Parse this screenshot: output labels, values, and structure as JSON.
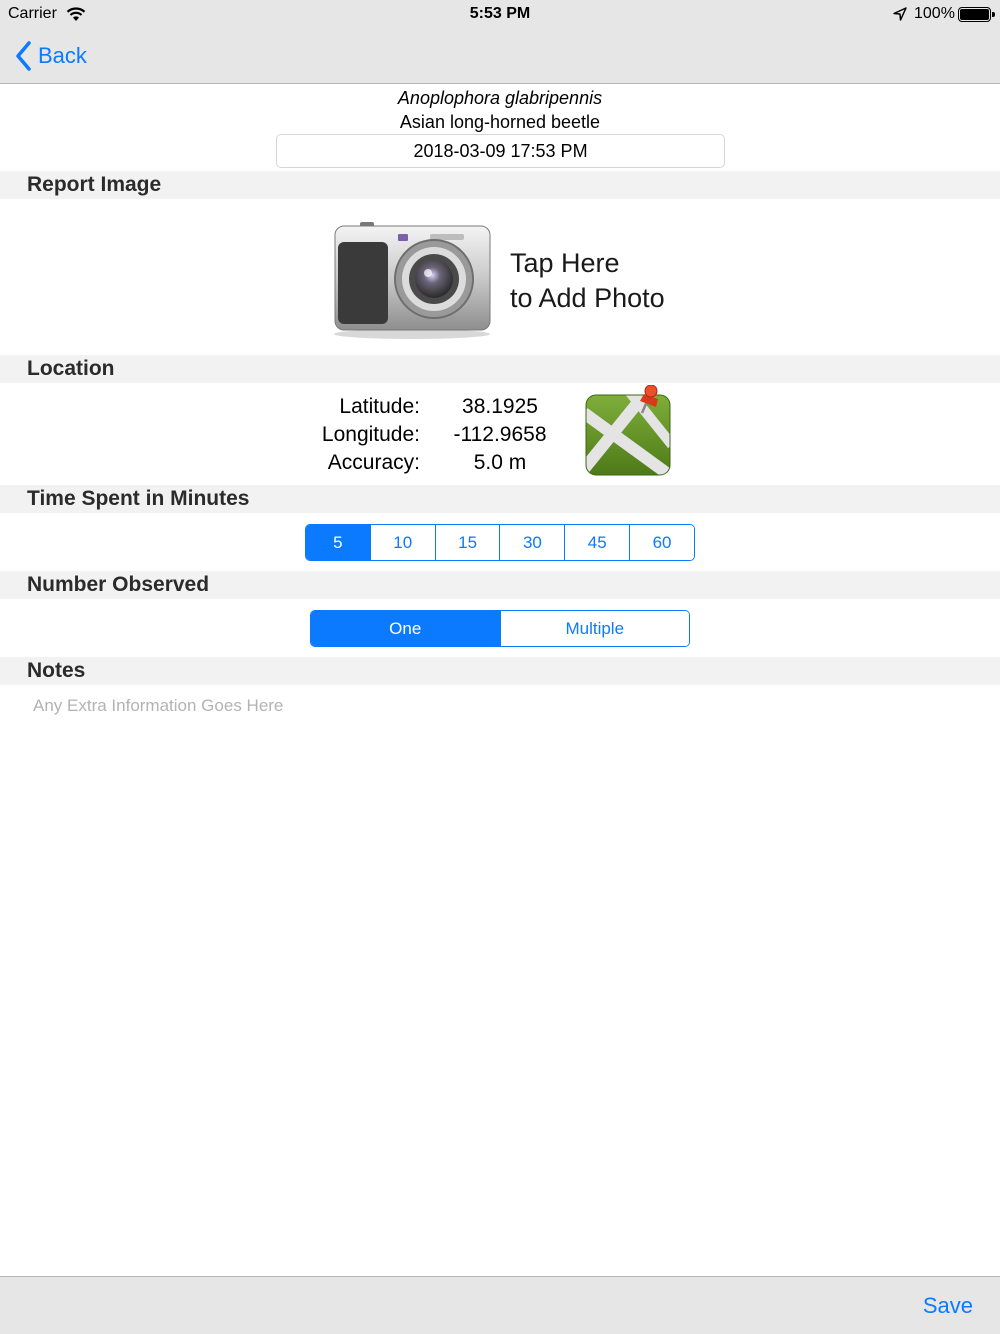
{
  "status_bar": {
    "carrier": "Carrier",
    "time": "5:53 PM",
    "battery": "100%"
  },
  "nav": {
    "back_label": "Back"
  },
  "species": {
    "scientific_name": "Anoplophora glabripennis",
    "common_name": "Asian long-horned beetle"
  },
  "report_date": "2018-03-09 17:53 PM",
  "sections": {
    "image": "Report Image",
    "location": "Location",
    "time_spent": "Time Spent in Minutes",
    "number_observed": "Number Observed",
    "notes": "Notes"
  },
  "photo": {
    "line1": "Tap Here",
    "line2": "to Add Photo"
  },
  "location": {
    "latitude_label": "Latitude:",
    "longitude_label": "Longitude:",
    "accuracy_label": "Accuracy:",
    "latitude": "38.1925",
    "longitude": "-112.9658",
    "accuracy": "5.0 m"
  },
  "time_options": [
    "5",
    "10",
    "15",
    "30",
    "45",
    "60"
  ],
  "time_selected": "5",
  "count_options": [
    "One",
    "Multiple"
  ],
  "count_selected": "One",
  "notes": {
    "placeholder": "Any Extra Information Goes Here",
    "value": ""
  },
  "toolbar": {
    "save_label": "Save"
  },
  "colors": {
    "accent": "#0b7aff",
    "bar_background": "#e6e6e6",
    "section_background": "#f2f2f2"
  }
}
